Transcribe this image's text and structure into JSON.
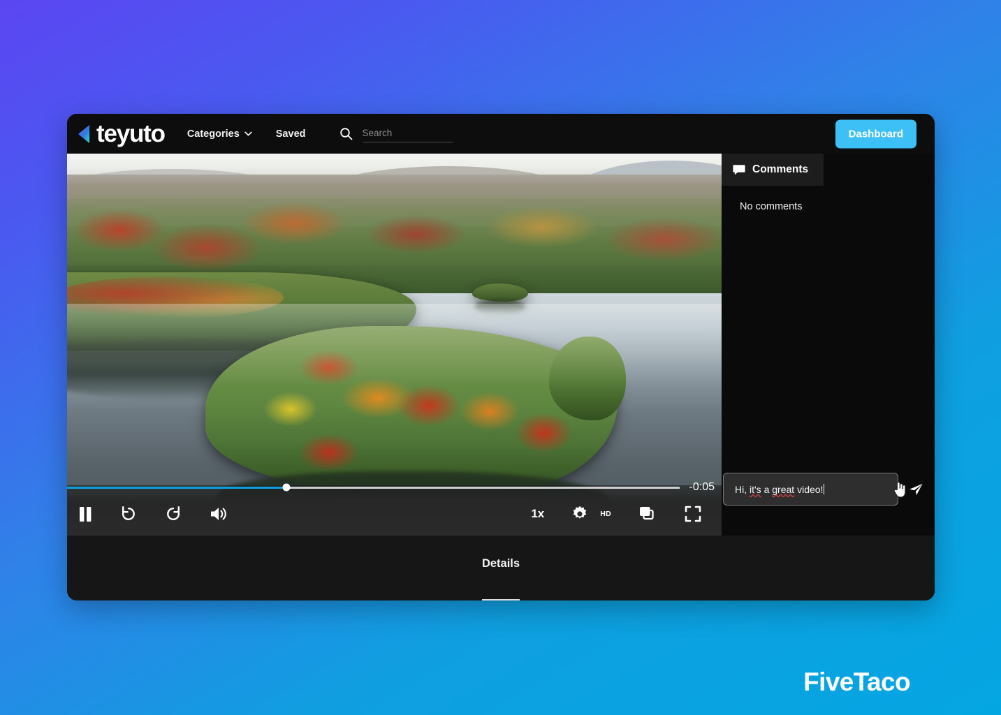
{
  "background": {
    "gradient_from": "#5b46f2",
    "gradient_to": "#04a6e2"
  },
  "watermark": {
    "text": "FiveTaco"
  },
  "topnav": {
    "logo_text": "teyuto",
    "logo_icon": "left-triangle-icon",
    "links": [
      {
        "label": "Categories",
        "has_chevron": true
      },
      {
        "label": "Saved",
        "has_chevron": false
      }
    ],
    "search": {
      "icon": "search-icon",
      "placeholder": "Search",
      "value": ""
    },
    "dashboard_button": {
      "label": "Dashboard",
      "color": "#3cc0f5"
    }
  },
  "player": {
    "time_remaining": "-0:05",
    "progress_percent": 35.8,
    "progress_color": "#0d9ee0",
    "speed_label": "1x",
    "quality_label": "HD",
    "controls": [
      {
        "name": "pause-button",
        "icon": "pause-icon"
      },
      {
        "name": "rewind-button",
        "icon": "rotate-left-icon"
      },
      {
        "name": "forward-button",
        "icon": "rotate-right-icon"
      },
      {
        "name": "volume-button",
        "icon": "volume-high-icon"
      },
      {
        "name": "speed-button",
        "icon": "speed-label"
      },
      {
        "name": "settings-button",
        "icon": "gear-icon"
      },
      {
        "name": "quality-button",
        "icon": "hd-label"
      },
      {
        "name": "pip-button",
        "icon": "picture-in-picture-icon"
      },
      {
        "name": "fullscreen-button",
        "icon": "fullscreen-icon"
      }
    ]
  },
  "comments": {
    "tab_label": "Comments",
    "tab_icon": "comment-bubble-icon",
    "empty_text": "No comments",
    "composer": {
      "value_pre": "Hi, ",
      "value_word1": "it's",
      "value_mid": " a ",
      "value_word2": "great",
      "value_post": " video!",
      "full_value": "Hi, it's a great video!",
      "placeholder": "",
      "send_icon": "send-paper-plane-icon",
      "cursor": "pointer-hand-cursor"
    }
  },
  "bottom": {
    "tabs": [
      {
        "label": "Details",
        "active": true
      }
    ]
  },
  "video_scene": {
    "description": "aerial autumn lake with forested island"
  }
}
